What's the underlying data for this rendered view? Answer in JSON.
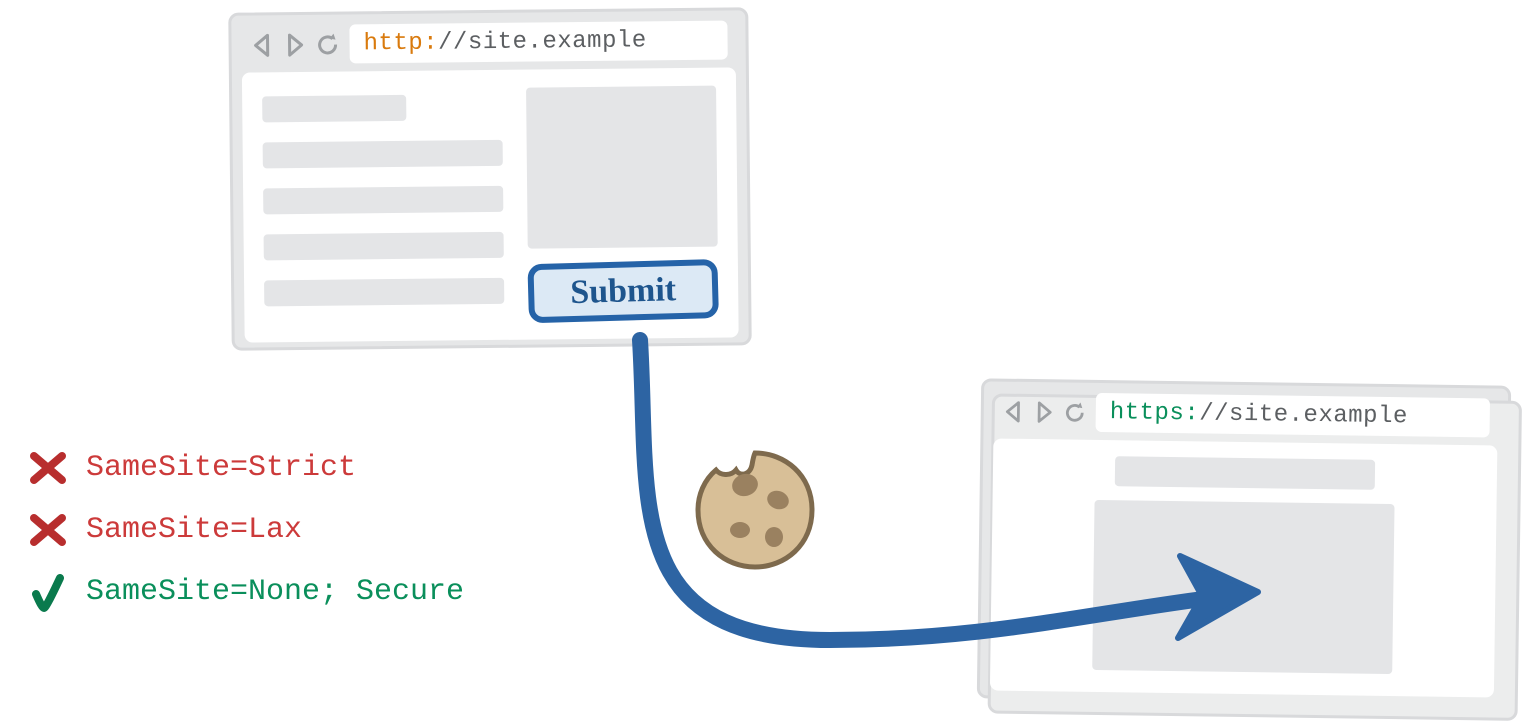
{
  "browser_source": {
    "url_scheme": "http:",
    "url_rest": "//site.example",
    "submit_label": "Submit"
  },
  "browser_dest": {
    "url_scheme": "https:",
    "url_rest": "//site.example"
  },
  "rules": [
    {
      "allowed": false,
      "text": "SameSite=Strict"
    },
    {
      "allowed": false,
      "text": "SameSite=Lax"
    },
    {
      "allowed": true,
      "text": "SameSite=None; Secure"
    }
  ],
  "icons": {
    "cookie": "cookie-icon",
    "back": "back-icon",
    "forward": "forward-icon",
    "reload": "reload-icon",
    "cross": "cross-icon",
    "check": "check-icon"
  }
}
